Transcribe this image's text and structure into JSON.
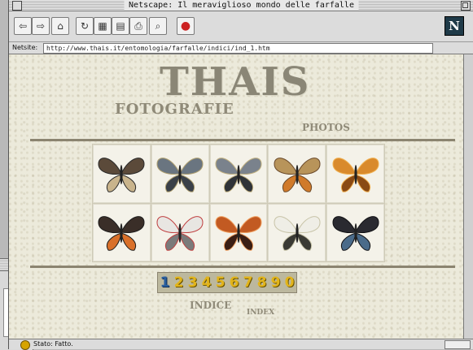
{
  "browser": {
    "title": "Netscape: Il meraviglioso mondo delle farfalle",
    "location_label": "Netsite:",
    "url": "http://www.thais.it/entomologia/farfalle/indici/ind_1.htm",
    "status_text": "Stato: Fatto.",
    "toolbar": [
      {
        "name": "back-button",
        "glyph": "⇦"
      },
      {
        "name": "forward-button",
        "glyph": "⇨"
      },
      {
        "name": "home-button",
        "glyph": "⌂"
      },
      {
        "name": "reload-button",
        "glyph": "↻"
      },
      {
        "name": "images-button",
        "glyph": "▦"
      },
      {
        "name": "open-button",
        "glyph": "▤"
      },
      {
        "name": "print-button",
        "glyph": "⎙"
      },
      {
        "name": "find-button",
        "glyph": "⌕"
      },
      {
        "name": "stop-button",
        "glyph": "●"
      }
    ],
    "logo_letter": "N"
  },
  "page": {
    "logo": "THAIS",
    "subtitle": "FOTOGRAFIE",
    "subtitle_en": "PHOTOS",
    "index_label": "INDICE",
    "index_label_en": "INDEX",
    "page_numbers": [
      "1",
      "2",
      "3",
      "4",
      "5",
      "6",
      "7",
      "8",
      "9",
      "0"
    ],
    "current_page": "1",
    "butterflies": [
      {
        "name": "butterfly-1",
        "colors": [
          "#5b4a3a",
          "#c9b48c",
          "#2a2a2a"
        ]
      },
      {
        "name": "butterfly-2",
        "colors": [
          "#6a7580",
          "#3a4048",
          "#b0a070"
        ]
      },
      {
        "name": "butterfly-3",
        "colors": [
          "#7a828c",
          "#2f3338",
          "#c0b080"
        ]
      },
      {
        "name": "butterfly-4",
        "colors": [
          "#b8945a",
          "#d07a2a",
          "#6b4a2a"
        ]
      },
      {
        "name": "butterfly-5",
        "colors": [
          "#d98a2c",
          "#8a4a14",
          "#f0b050"
        ]
      },
      {
        "name": "butterfly-6",
        "colors": [
          "#3a2e28",
          "#d9702a",
          "#1c1c1c"
        ]
      },
      {
        "name": "butterfly-7",
        "colors": [
          "#e8e6e2",
          "#7a7a7a",
          "#c04040"
        ]
      },
      {
        "name": "butterfly-8",
        "colors": [
          "#c25a22",
          "#3a1e14",
          "#f0a060"
        ]
      },
      {
        "name": "butterfly-9",
        "colors": [
          "#efeee6",
          "#3a3a34",
          "#c8c4a8"
        ]
      },
      {
        "name": "butterfly-10",
        "colors": [
          "#2a2a30",
          "#4a6b8a",
          "#111114"
        ]
      }
    ]
  }
}
